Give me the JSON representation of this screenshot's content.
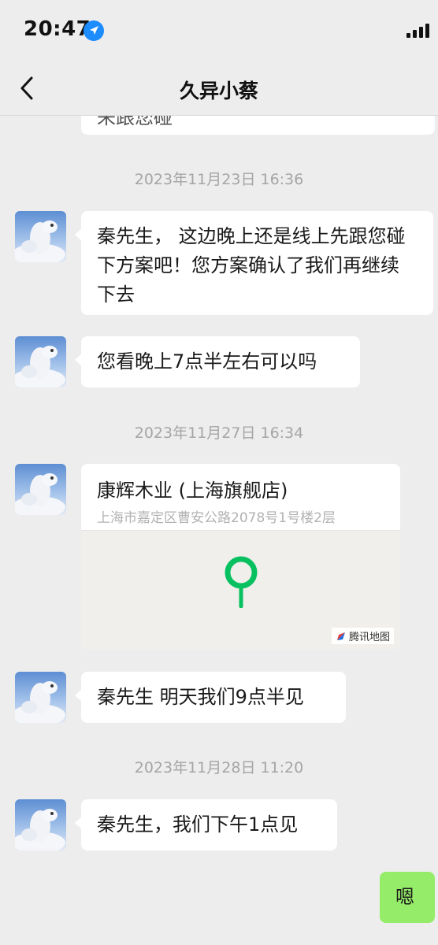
{
  "status_bar": {
    "time": "20:47",
    "location_icon": "location-arrow-icon",
    "signal_icon": "cellular-signal-icon"
  },
  "nav": {
    "back_icon": "chevron-left-icon",
    "title": "久异小蔡"
  },
  "colors": {
    "background": "#ededed",
    "bubble_incoming": "#ffffff",
    "bubble_outgoing": "#95ec69",
    "timestamp": "#a5a5a5",
    "map_pin": "#07c160"
  },
  "messages": [
    {
      "type": "partial_text",
      "sender": "contact",
      "text": "来跟您碰"
    },
    {
      "type": "timestamp",
      "text": "2023年11月23日 16:36"
    },
    {
      "type": "text",
      "sender": "contact",
      "text": "秦先生， 这边晚上还是线上先跟您碰下方案吧！您方案确认了我们再继续下去"
    },
    {
      "type": "text",
      "sender": "contact",
      "text": "您看晚上7点半左右可以吗"
    },
    {
      "type": "timestamp",
      "text": "2023年11月27日 16:34"
    },
    {
      "type": "location",
      "sender": "contact",
      "name": "康辉木业 (上海旗舰店)",
      "address": "上海市嘉定区曹安公路2078号1号楼2层",
      "map_provider": "腾讯地图"
    },
    {
      "type": "text",
      "sender": "contact",
      "text": "秦先生 明天我们9点半见"
    },
    {
      "type": "timestamp",
      "text": "2023年11月28日 11:20"
    },
    {
      "type": "text",
      "sender": "contact",
      "text": "秦先生，我们下午1点见"
    },
    {
      "type": "text",
      "sender": "me",
      "text": "嗯"
    }
  ]
}
